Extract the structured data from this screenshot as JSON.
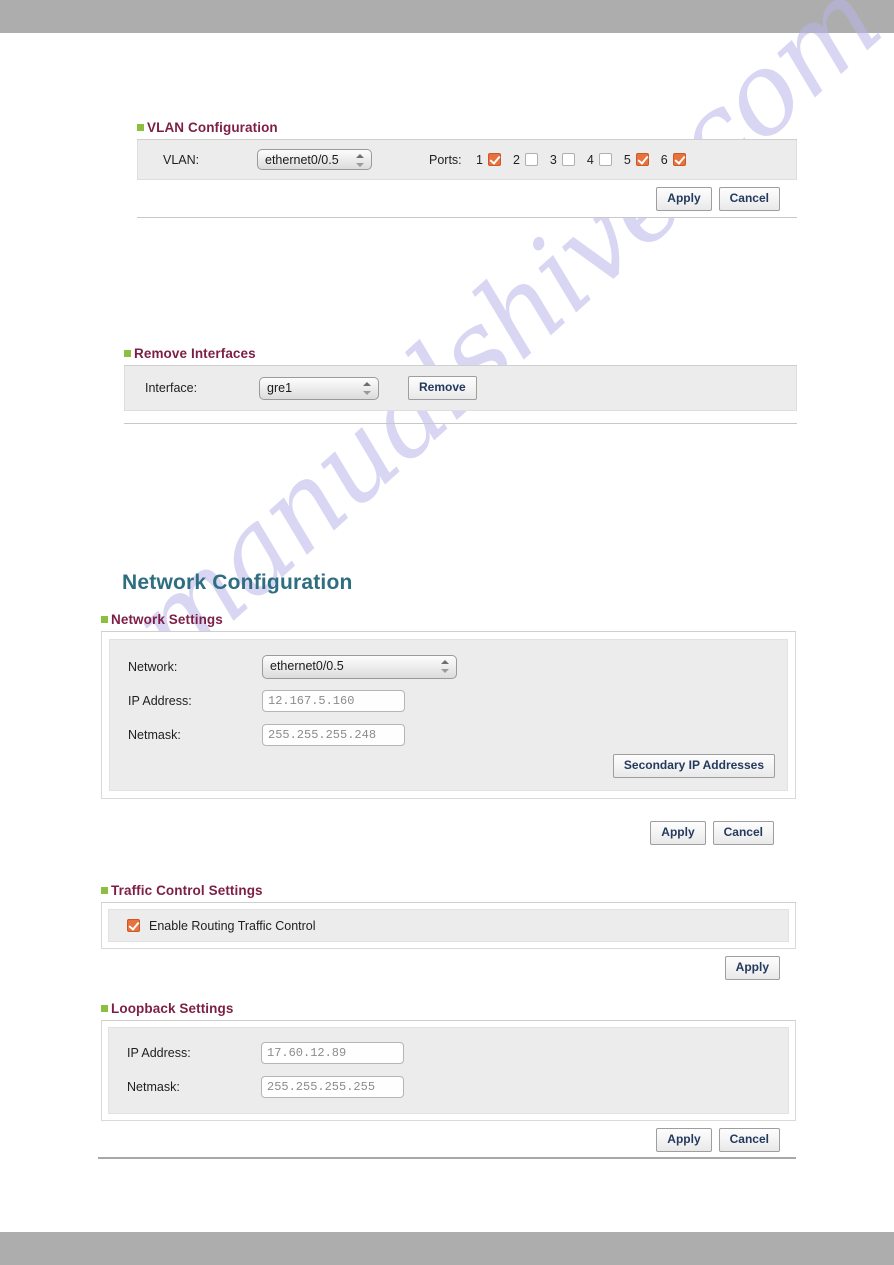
{
  "page": {
    "title": "Network Configuration",
    "watermark": "manualshive.com",
    "colors": {
      "chrome_bar": "#adadad",
      "section_header": "#7d1f44",
      "bullet": "#8cbf3f",
      "title": "#2e6e80",
      "checkbox_checked": "#e8713c",
      "panel_bg": "#ececec",
      "button_text": "#243a5e"
    }
  },
  "vlan_section": {
    "header": "VLAN Configuration",
    "bullet_icon": "green-square-bullet",
    "vlan_label": "VLAN:",
    "vlan_select_value": "ethernet0/0.5",
    "ports_label": "Ports:",
    "ports": [
      {
        "number": "1",
        "checked": true
      },
      {
        "number": "2",
        "checked": false
      },
      {
        "number": "3",
        "checked": false
      },
      {
        "number": "4",
        "checked": false
      },
      {
        "number": "5",
        "checked": true
      },
      {
        "number": "6",
        "checked": true
      }
    ],
    "apply_label": "Apply",
    "cancel_label": "Cancel"
  },
  "remove_section": {
    "header": "Remove Interfaces",
    "bullet_icon": "green-square-bullet",
    "interface_label": "Interface:",
    "interface_select_value": "gre1",
    "remove_label": "Remove"
  },
  "network_section": {
    "header": "Network Settings",
    "bullet_icon": "green-square-bullet",
    "network_label": "Network:",
    "network_select_value": "ethernet0/0.5",
    "ip_label": "IP Address:",
    "ip_value": "12.167.5.160",
    "netmask_label": "Netmask:",
    "netmask_value": "255.255.255.248",
    "secondary_button": "Secondary IP Addresses",
    "apply_label": "Apply",
    "cancel_label": "Cancel"
  },
  "traffic_section": {
    "header": "Traffic Control Settings",
    "bullet_icon": "green-square-bullet",
    "enable_label": "Enable Routing Traffic Control",
    "enable_checked": true,
    "apply_label": "Apply"
  },
  "loopback_section": {
    "header": "Loopback Settings",
    "bullet_icon": "green-square-bullet",
    "ip_label": "IP Address:",
    "ip_value": "17.60.12.89",
    "netmask_label": "Netmask:",
    "netmask_value": "255.255.255.255",
    "apply_label": "Apply",
    "cancel_label": "Cancel"
  }
}
